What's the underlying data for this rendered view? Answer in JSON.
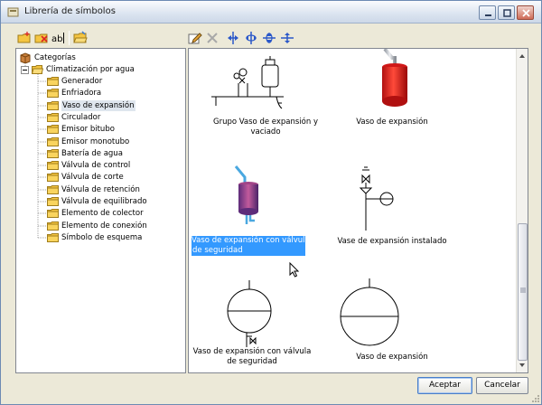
{
  "window": {
    "title": "Librería de símbolos"
  },
  "tree": {
    "root_label": "Categorías",
    "group_label": "Climatización por agua",
    "items": [
      "Generador",
      "Enfriadora",
      "Vaso de expansión",
      "Circulador",
      "Emisor bitubo",
      "Emisor monotubo",
      "Batería de agua",
      "Válvula de control",
      "Válvula de corte",
      "Válvula de retención",
      "Válvula de equilibrado",
      "Elemento de colector",
      "Elemento de conexión",
      "Símbolo de esquema"
    ],
    "selected_index": 2
  },
  "gallery": {
    "items": [
      {
        "caption": [
          "Grupo Vaso de expansión y",
          "vaciado"
        ]
      },
      {
        "caption": [
          "Vaso de expansión"
        ]
      },
      {
        "caption": [
          "Vaso de expansión con válvula",
          "de seguridad"
        ]
      },
      {
        "caption": [
          "Vase de expansión instalado"
        ]
      },
      {
        "caption": [
          "Vaso de expansión con válvula",
          "de seguridad"
        ]
      },
      {
        "caption": [
          "Vaso de expansión"
        ]
      }
    ],
    "selected_index": 2
  },
  "buttons": {
    "ok": "Aceptar",
    "cancel": "Cancelar"
  },
  "colors": {
    "selection": "#3399ff",
    "vessel_red": "#e02020",
    "vessel_purple": "#9b3a8a",
    "pipe_blue": "#4aa8e0"
  }
}
